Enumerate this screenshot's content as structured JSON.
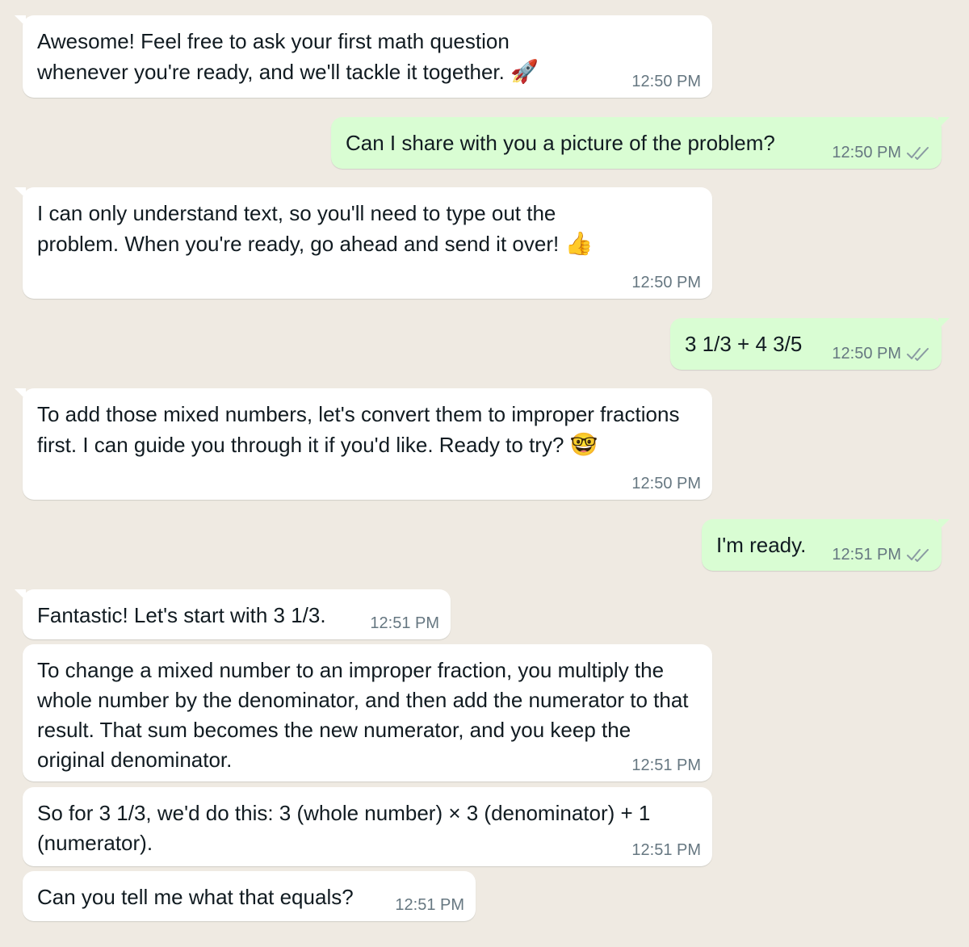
{
  "messages": [
    {
      "dir": "in",
      "text": "Awesome! Feel free to ask your first math question whenever you're ready, and we'll tackle it together.",
      "emoji": "🚀",
      "time": "12:50 PM"
    },
    {
      "dir": "out",
      "text": "Can I share with you a picture of the problem?",
      "time": "12:50 PM",
      "status": "read"
    },
    {
      "dir": "in",
      "text": "I can only understand text, so you'll need to type out the problem. When you're ready, go ahead and send it over!",
      "emoji": "👍",
      "time": "12:50 PM"
    },
    {
      "dir": "out",
      "text": "3 1/3 + 4 3/5",
      "time": "12:50 PM",
      "status": "read"
    },
    {
      "dir": "in",
      "text": "To add those mixed numbers, let's convert them to improper fractions first. I can guide you through it if you'd like. Ready to try?",
      "emoji": "🤓",
      "time": "12:50 PM"
    },
    {
      "dir": "out",
      "text": "I'm ready.",
      "time": "12:51 PM",
      "status": "read"
    },
    {
      "dir": "in",
      "text": "Fantastic! Let's start with 3 1/3.",
      "time": "12:51 PM"
    },
    {
      "dir": "in",
      "text": "To change a mixed number to an improper fraction, you multiply the whole number by the denominator, and then add the numerator to that result. That sum becomes the new numerator, and you keep the original denominator.",
      "time": "12:51 PM"
    },
    {
      "dir": "in",
      "text": "So for 3 1/3, we'd do this: 3 (whole number) × 3 (denominator) + 1 (numerator).",
      "time": "12:51 PM"
    },
    {
      "dir": "in",
      "text": "Can you tell me what that equals?",
      "time": "12:51 PM"
    }
  ],
  "icons": {
    "read_status": "double-check-icon"
  },
  "colors": {
    "background": "#efeae2",
    "incoming": "#ffffff",
    "outgoing": "#d9fdd3",
    "time": "#667781"
  }
}
